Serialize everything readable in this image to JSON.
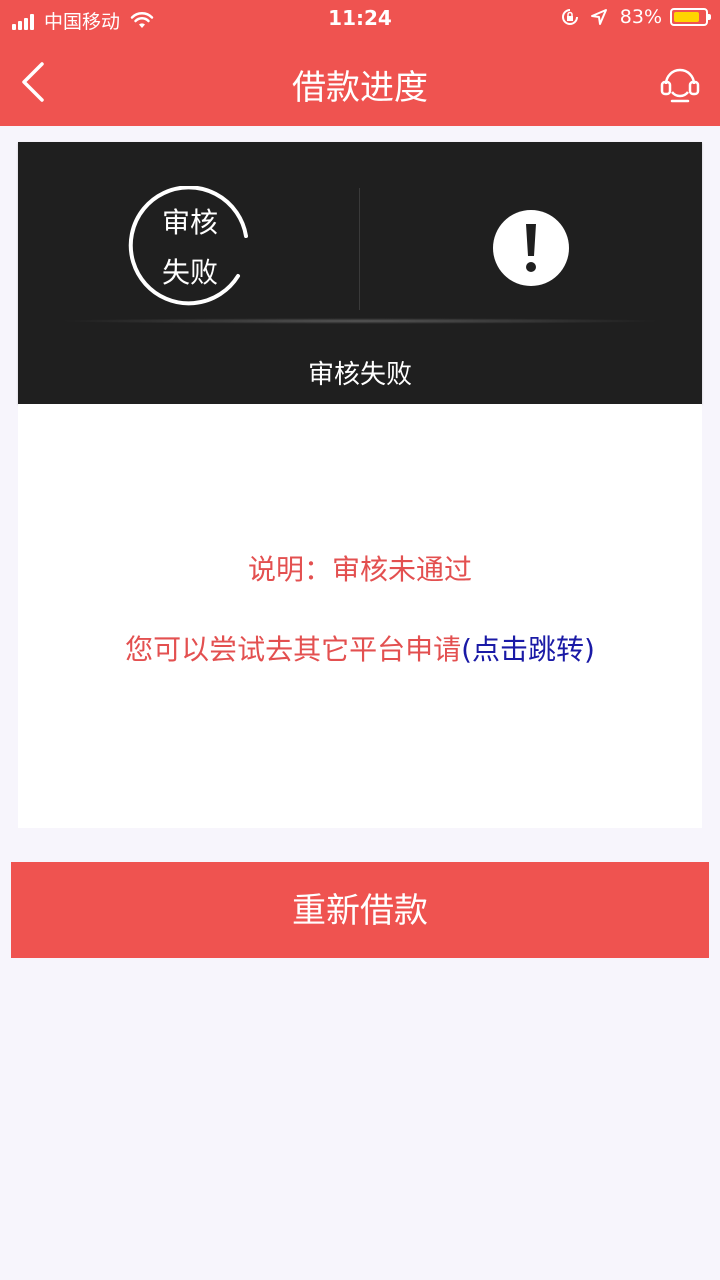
{
  "status_bar": {
    "carrier": "中国移动",
    "time": "11:24",
    "battery_percent": "83%",
    "battery_level": 0.83,
    "icons": [
      "signal-icon",
      "wifi-icon",
      "orientation-lock-icon",
      "location-icon",
      "battery-icon"
    ]
  },
  "nav": {
    "title": "借款进度",
    "back_icon": "chevron-left-icon",
    "support_icon": "headset-icon"
  },
  "status_card": {
    "circle_line1": "审核",
    "circle_line2": "失败",
    "caption": "审核失败",
    "warning_icon": "exclamation-circle-icon"
  },
  "details": {
    "description": "说明：审核未通过",
    "hint_text": "您可以尝试去其它平台申请",
    "hint_link": "(点击跳转)"
  },
  "actions": {
    "retry_label": "重新借款"
  },
  "colors": {
    "brand_red": "#ef5350",
    "text_red": "#e35050",
    "link_blue": "#1a1aa6",
    "card_dark": "#1f1f1f",
    "battery_yellow": "#ffd400"
  }
}
